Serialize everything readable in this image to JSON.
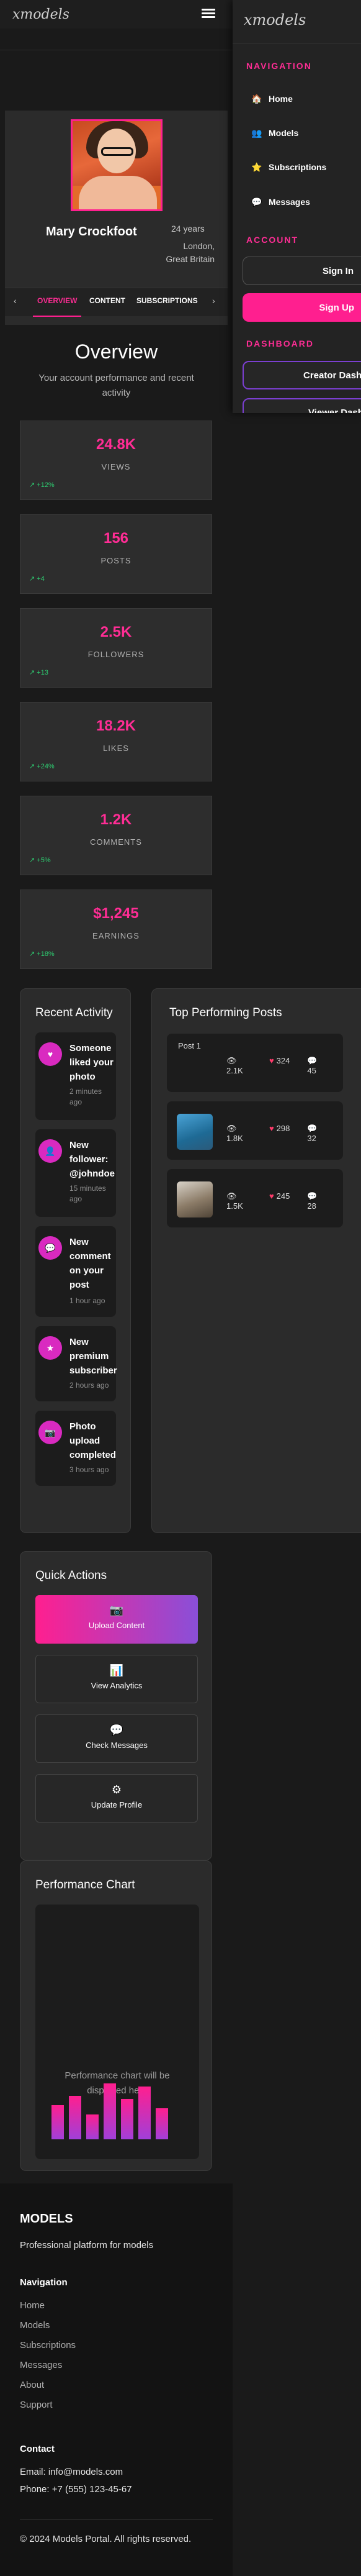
{
  "app": {
    "logo": "xmodels"
  },
  "side_menu": {
    "logo": "xmodels",
    "navigation_title": "NAVIGATION",
    "nav_items": [
      {
        "icon": "home-icon",
        "glyph": "🏠",
        "label": "Home"
      },
      {
        "icon": "people-icon",
        "glyph": "👥",
        "label": "Models"
      },
      {
        "icon": "star-icon",
        "glyph": "⭐",
        "label": "Subscriptions"
      },
      {
        "icon": "message-icon",
        "glyph": "💬",
        "label": "Messages"
      }
    ],
    "account_title": "ACCOUNT",
    "sign_in": "Sign In",
    "sign_up": "Sign Up",
    "dashboard_title": "DASHBOARD",
    "creator_dashboard": "Creator Dashboard",
    "viewer_dashboard": "Viewer Dashboard"
  },
  "profile": {
    "name": "Mary Crockfoot",
    "age": "24 years",
    "location": "London, Great Britain",
    "tabs": [
      "OVERVIEW",
      "CONTENT",
      "SUBSCRIPTIONS"
    ],
    "active_tab": "OVERVIEW"
  },
  "overview": {
    "title": "Overview",
    "subtitle": "Your account performance and recent activity",
    "stats": [
      {
        "value": "24.8K",
        "label": "VIEWS",
        "change": "↗ +12%"
      },
      {
        "value": "156",
        "label": "POSTS",
        "change": "↗ +4"
      },
      {
        "value": "2.5K",
        "label": "FOLLOWERS",
        "change": "↗ +13"
      },
      {
        "value": "18.2K",
        "label": "LIKES",
        "change": "↗ +24%"
      },
      {
        "value": "1.2K",
        "label": "COMMENTS",
        "change": "↗ +5%"
      },
      {
        "value": "$1,245",
        "label": "EARNINGS",
        "change": "↗ +18%"
      }
    ]
  },
  "recent_activity": {
    "title": "Recent Activity",
    "items": [
      {
        "icon": "heart-icon",
        "glyph": "♥",
        "text": "Someone liked your photo",
        "time": "2 minutes ago"
      },
      {
        "icon": "user-icon",
        "glyph": "👤",
        "text": "New follower: @johndoe",
        "time": "15 minutes ago"
      },
      {
        "icon": "comment-icon",
        "glyph": "💬",
        "text": "New comment on your post",
        "time": "1 hour ago"
      },
      {
        "icon": "star-icon",
        "glyph": "★",
        "text": "New premium subscriber",
        "time": "2 hours ago"
      },
      {
        "icon": "camera-icon",
        "glyph": "📷",
        "text": "Photo upload completed",
        "time": "3 hours ago"
      }
    ]
  },
  "top_posts": {
    "title": "Top Performing Posts",
    "posts": [
      {
        "alt": "Post 1",
        "views": "2.1K",
        "likes": "324",
        "comments": "45"
      },
      {
        "alt": "",
        "views": "1.8K",
        "likes": "298",
        "comments": "32"
      },
      {
        "alt": "",
        "views": "1.5K",
        "likes": "245",
        "comments": "28"
      }
    ]
  },
  "quick_actions": {
    "title": "Quick Actions",
    "items": [
      {
        "icon": "upload-icon",
        "glyph": "📷",
        "label": "Upload Content"
      },
      {
        "icon": "analytics-icon",
        "glyph": "📊",
        "label": "View Analytics"
      },
      {
        "icon": "messages-icon",
        "glyph": "💬",
        "label": "Check Messages"
      },
      {
        "icon": "settings-icon",
        "glyph": "⚙",
        "label": "Update Profile"
      }
    ]
  },
  "performance": {
    "title": "Performance Chart",
    "placeholder": "Performance chart will be displayed here",
    "bar_levels": [
      0.55,
      0.7,
      0.4,
      0.9,
      0.65,
      0.85,
      0.5
    ]
  },
  "footer": {
    "brand": "MODELS",
    "tagline": "Professional platform for models",
    "nav_title": "Navigation",
    "links": [
      "Home",
      "Models",
      "Subscriptions",
      "Messages",
      "About",
      "Support"
    ],
    "contact_title": "Contact",
    "email": "Email: info@models.com",
    "phone": "Phone: +7 (555) 123-45-67",
    "copyright": "© 2024 Models Portal. All rights reserved."
  }
}
